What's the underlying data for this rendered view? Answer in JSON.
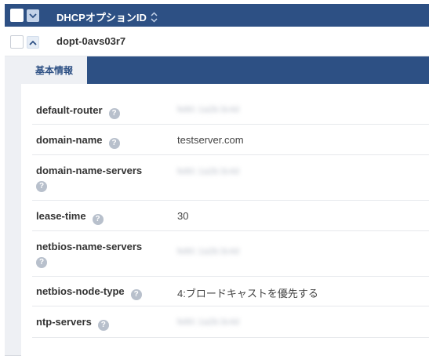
{
  "header": {
    "column_title": "DHCPオプションID",
    "sort_icon": "sort-icon",
    "chevron_icon": "chevron-down-icon"
  },
  "row": {
    "id": "dopt-0avs03r7",
    "chevron_icon": "chevron-up-icon"
  },
  "detail": {
    "tabs": [
      {
        "label": "基本情報",
        "active": true
      }
    ],
    "properties": [
      {
        "key": "default-router",
        "value": "fe80::1a2b:3c4d",
        "masked": true
      },
      {
        "key": "domain-name",
        "value": "testserver.com",
        "masked": false
      },
      {
        "key": "domain-name-servers",
        "value": "fe80::1a2b:3c4d",
        "masked": true
      },
      {
        "key": "lease-time",
        "value": "30",
        "masked": false
      },
      {
        "key": "netbios-name-servers",
        "value": "fe80::1a2b:3c4d",
        "masked": true
      },
      {
        "key": "netbios-node-type",
        "value": "4:ブロードキャストを優先する",
        "masked": false
      },
      {
        "key": "ntp-servers",
        "value": "fe80::1a2b:3c4d",
        "masked": true
      }
    ],
    "help_icon_glyph": "?"
  },
  "colors": {
    "header_bg": "#2d5084",
    "panel_bg": "#ffffff",
    "detail_bg": "#eef0f4",
    "help_icon": "#b8c0cc"
  }
}
